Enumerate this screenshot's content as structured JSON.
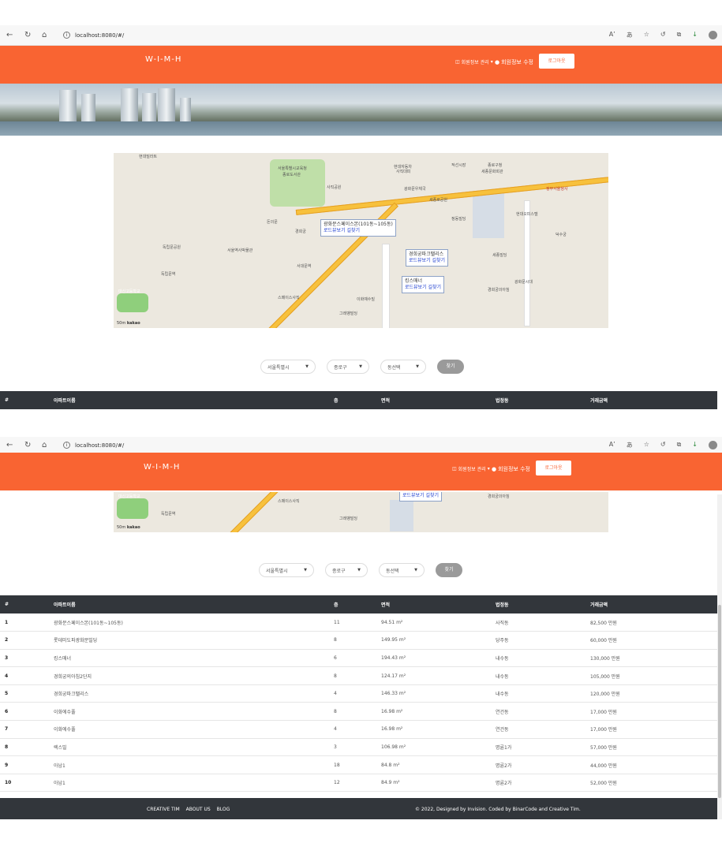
{
  "browser": {
    "url": "localhost:8080/#/",
    "nav_icons": [
      "back-icon",
      "refresh-icon",
      "home-icon"
    ],
    "right_icons": [
      "read-aloud-icon",
      "translate-icon",
      "favorite-add-icon",
      "refresh-icon",
      "collections-icon",
      "download-icon",
      "profile-icon"
    ]
  },
  "navbar": {
    "brand": "W-I-M-H",
    "member_manage": "회원정보 관리",
    "member_edit": "회원정보 수정",
    "logout": "로그아웃",
    "color": "#f96432"
  },
  "map": {
    "labels": {
      "l1": "현대빌라트",
      "l2": "서울특별시교육청",
      "l3": "종로도서관",
      "l4": "사직공원",
      "l5": "현대자동차",
      "l6": "사직대피",
      "l7": "적선시장",
      "l8": "종로구청",
      "l9": "세종문화회관",
      "l10": "광화문우체국",
      "l11": "세종로공원",
      "l12": "정부서울청사",
      "l13": "독립문공원",
      "l14": "돈의문",
      "l15": "서울역사박물관",
      "l16": "경희궁",
      "l17": "대신고등학교",
      "l18": "현대오피스텔",
      "l19": "정동빌딩",
      "l20": "덕수궁",
      "l21": "그레뱅빌딩",
      "l22": "세종빌딩",
      "l23": "서대문역",
      "l24": "경희궁의아침",
      "l25": "광화문시대",
      "l26": "독립문역",
      "l27": "이화예수빌",
      "l28": "스페이스사직"
    },
    "infowindows": [
      {
        "name": "광화문스페이스본(101동~105동)",
        "link": "로드뷰보기 길찾기"
      },
      {
        "name": "경희궁파크팰리스",
        "link": "로드뷰보기 길찾기"
      },
      {
        "name": "킹스매너",
        "link": "로드뷰보기 길찾기"
      }
    ],
    "scale": "50m",
    "provider": "kakao"
  },
  "filters": {
    "city": "서울특별시",
    "district": "종로구",
    "dong": "동선택",
    "find": "찾기"
  },
  "table": {
    "headers": [
      "#",
      "아파트이름",
      "층",
      "면적",
      "법정동",
      "거래금액"
    ],
    "rows": [
      {
        "idx": "1",
        "name": "광화문스페이스본(101동~105동)",
        "floor": "11",
        "area": "94.51 m²",
        "dong": "사직동",
        "price": "82,500 만원"
      },
      {
        "idx": "2",
        "name": "롯데미도파광화문빌딩",
        "floor": "8",
        "area": "149.95 m²",
        "dong": "당주동",
        "price": "60,000 만원"
      },
      {
        "idx": "3",
        "name": "킹스매너",
        "floor": "6",
        "area": "194.43 m²",
        "dong": "내수동",
        "price": "130,000 만원"
      },
      {
        "idx": "4",
        "name": "경희궁의아침2단지",
        "floor": "8",
        "area": "124.17 m²",
        "dong": "내수동",
        "price": "105,000 만원"
      },
      {
        "idx": "5",
        "name": "경희궁파크팰리스",
        "floor": "4",
        "area": "146.33 m²",
        "dong": "내수동",
        "price": "120,000 만원"
      },
      {
        "idx": "6",
        "name": "이화에수풀",
        "floor": "8",
        "area": "16.98 m²",
        "dong": "연건동",
        "price": "17,000 만원"
      },
      {
        "idx": "7",
        "name": "이화에수풀",
        "floor": "4",
        "area": "16.98 m²",
        "dong": "연건동",
        "price": "17,000 만원"
      },
      {
        "idx": "8",
        "name": "렉스빌",
        "floor": "3",
        "area": "106.98 m²",
        "dong": "명륜1가",
        "price": "57,000 만원"
      },
      {
        "idx": "9",
        "name": "아남1",
        "floor": "18",
        "area": "84.8 m²",
        "dong": "명륜2가",
        "price": "44,000 만원"
      },
      {
        "idx": "10",
        "name": "아남1",
        "floor": "12",
        "area": "84.9 m²",
        "dong": "명륜2가",
        "price": "52,000 만원"
      }
    ]
  },
  "footer": {
    "links": [
      "CREATIVE TIM",
      "ABOUT US",
      "BLOG"
    ],
    "copyright": "© 2022, Designed by Invision. Coded by BinarCode and Creative Tim."
  }
}
